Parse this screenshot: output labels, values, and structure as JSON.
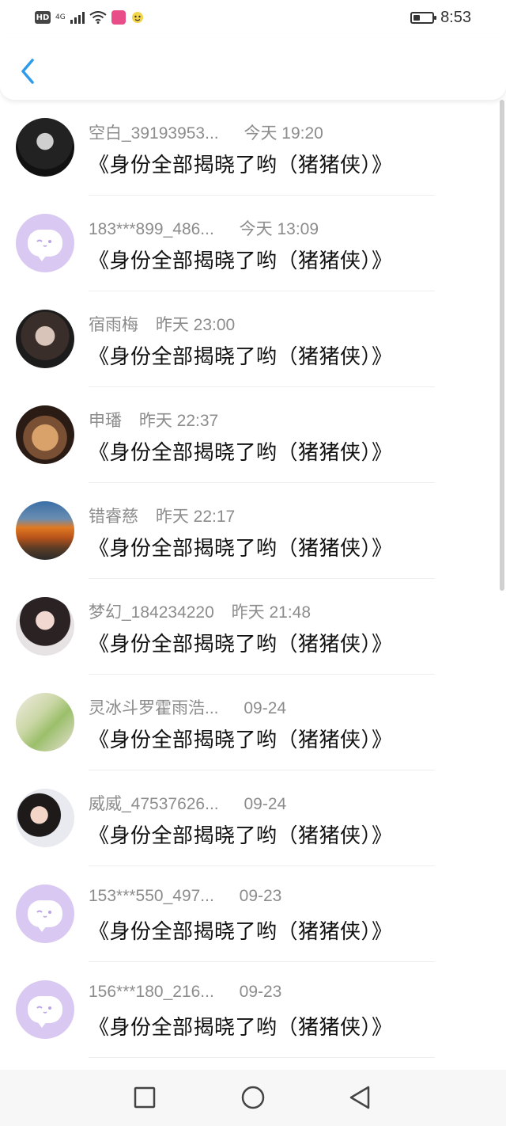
{
  "status_bar": {
    "hd": "HD",
    "network": "4G",
    "time": "8:53",
    "icons": [
      "hd-icon",
      "signal-icon",
      "wifi-icon",
      "app-notification-icon",
      "app-notification-icon-2",
      "battery-icon"
    ]
  },
  "nav": {
    "back_icon": "chevron-left-icon",
    "accent": "#2f9bea"
  },
  "items": [
    {
      "name": "空白_39193953...",
      "time": "今天 19:20",
      "title": "《身份全部揭晓了哟（猪猪侠）》",
      "avatar": "photo"
    },
    {
      "name": "183***899_486...",
      "time": "今天 13:09",
      "title": "《身份全部揭晓了哟（猪猪侠）》",
      "avatar": "default"
    },
    {
      "name": "宿雨梅",
      "time": "昨天 23:00",
      "title": "《身份全部揭晓了哟（猪猪侠）》",
      "avatar": "photo"
    },
    {
      "name": "申璠",
      "time": "昨天 22:37",
      "title": "《身份全部揭晓了哟（猪猪侠）》",
      "avatar": "photo"
    },
    {
      "name": "错睿慈",
      "time": "昨天 22:17",
      "title": "《身份全部揭晓了哟（猪猪侠）》",
      "avatar": "photo"
    },
    {
      "name": "梦幻_184234220",
      "time": "昨天 21:48",
      "title": "《身份全部揭晓了哟（猪猪侠）》",
      "avatar": "photo"
    },
    {
      "name": "灵冰斗罗霍雨浩...",
      "time": "09-24",
      "title": "《身份全部揭晓了哟（猪猪侠）》",
      "avatar": "photo"
    },
    {
      "name": "威威_47537626...",
      "time": "09-24",
      "title": "《身份全部揭晓了哟（猪猪侠）》",
      "avatar": "photo"
    },
    {
      "name": "153***550_497...",
      "time": "09-23",
      "title": "《身份全部揭晓了哟（猪猪侠）》",
      "avatar": "default"
    },
    {
      "name": "156***180_216...",
      "time": "09-23",
      "title": "《身份全部揭晓了哟（猪猪侠）》",
      "avatar": "default"
    }
  ],
  "system_nav": {
    "recent_icon": "square-icon",
    "home_icon": "circle-icon",
    "back_icon": "triangle-back-icon"
  },
  "colors": {
    "default_avatar_bg": "#d9c8f2",
    "meta_text": "#8c8c8c",
    "title_text": "#111111"
  }
}
